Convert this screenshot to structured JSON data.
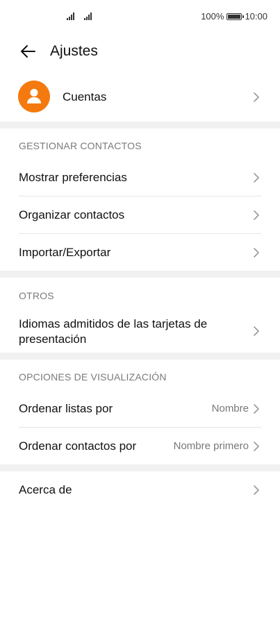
{
  "status": {
    "battery_pct": "100%",
    "time": "10:00"
  },
  "header": {
    "title": "Ajustes"
  },
  "account": {
    "label": "Cuentas"
  },
  "sections": {
    "manage": {
      "title": "GESTIONAR CONTACTOS",
      "items": [
        "Mostrar preferencias",
        "Organizar contactos",
        "Importar/Exportar"
      ]
    },
    "others": {
      "title": "OTROS",
      "items": [
        "Idiomas admitidos de las tarjetas de presentación"
      ]
    },
    "display": {
      "title": "OPCIONES DE VISUALIZACIÓN",
      "items": [
        {
          "label": "Ordenar listas por",
          "value": "Nombre"
        },
        {
          "label": "Ordenar contactos por",
          "value": "Nombre primero"
        }
      ]
    },
    "about": {
      "label": "Acerca de"
    }
  },
  "colors": {
    "accent": "#f47a0f",
    "divider": "#e6e6e6",
    "section_bg": "#f1f1f1"
  }
}
